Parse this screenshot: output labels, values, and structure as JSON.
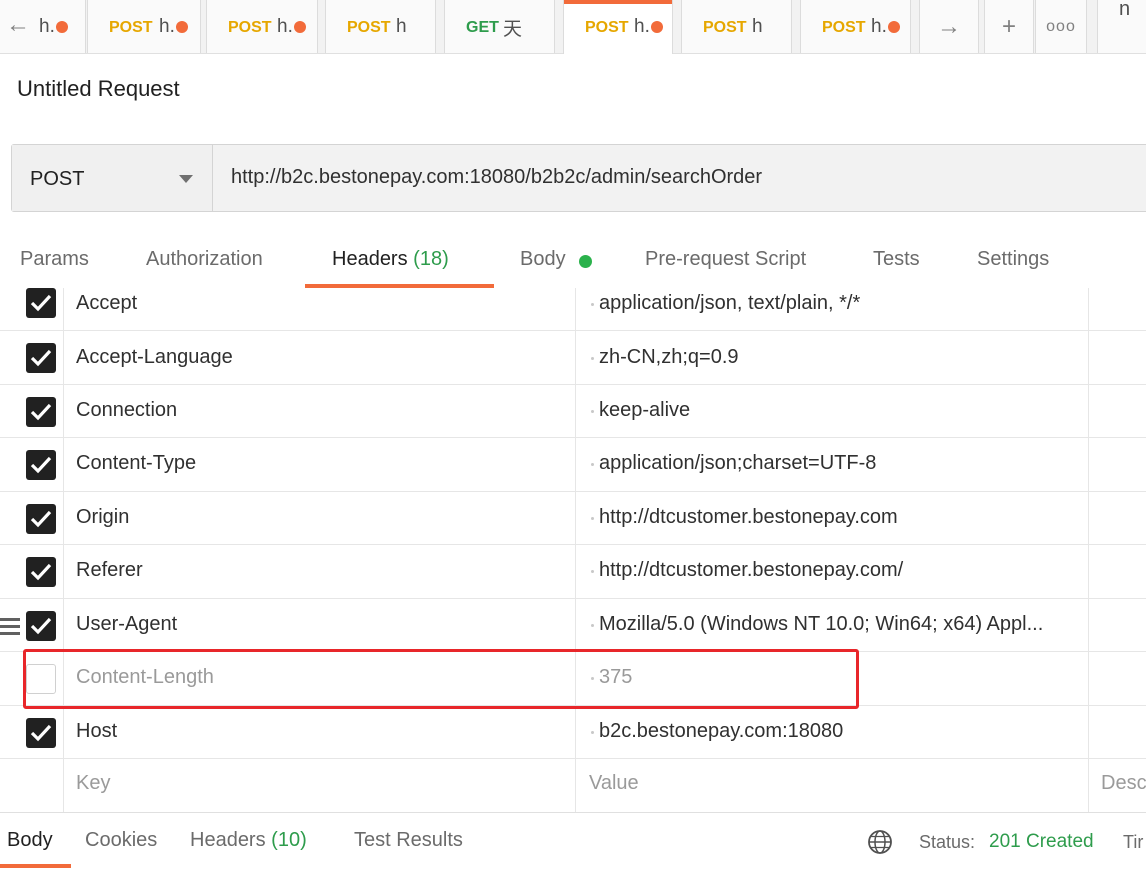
{
  "tabs": {
    "back_label": "h.",
    "items": [
      {
        "method": "POST",
        "name": "h."
      },
      {
        "method": "POST",
        "name": "h."
      },
      {
        "method": "POST",
        "name": "h"
      },
      {
        "method": "GET",
        "name": "天"
      },
      {
        "method": "POST",
        "name": "h."
      },
      {
        "method": "POST",
        "name": "h"
      },
      {
        "method": "POST",
        "name": "h."
      }
    ],
    "env_label": "n"
  },
  "request": {
    "title": "Untitled Request",
    "method": "POST",
    "url": "http://b2c.bestonepay.com:18080/b2b2c/admin/searchOrder"
  },
  "request_tabs": {
    "params": "Params",
    "authorization": "Authorization",
    "headers": "Headers",
    "headers_count": "(18)",
    "body": "Body",
    "pre_request": "Pre-request Script",
    "tests": "Tests",
    "settings": "Settings"
  },
  "headers": [
    {
      "key": "Accept",
      "value": "application/json, text/plain, */*",
      "enabled": true
    },
    {
      "key": "Accept-Language",
      "value": "zh-CN,zh;q=0.9",
      "enabled": true
    },
    {
      "key": "Connection",
      "value": "keep-alive",
      "enabled": true
    },
    {
      "key": "Content-Type",
      "value": "application/json;charset=UTF-8",
      "enabled": true
    },
    {
      "key": "Origin",
      "value": "http://dtcustomer.bestonepay.com",
      "enabled": true
    },
    {
      "key": "Referer",
      "value": "http://dtcustomer.bestonepay.com/",
      "enabled": true
    },
    {
      "key": "User-Agent",
      "value": "Mozilla/5.0 (Windows NT 10.0; Win64; x64) Appl...",
      "enabled": true
    },
    {
      "key": "Content-Length",
      "value": "375",
      "enabled": false
    },
    {
      "key": "Host",
      "value": "b2c.bestonepay.com:18080",
      "enabled": true
    }
  ],
  "new_row": {
    "key_placeholder": "Key",
    "value_placeholder": "Value",
    "desc_placeholder": "Desc"
  },
  "response": {
    "tabs": {
      "body": "Body",
      "cookies": "Cookies",
      "headers": "Headers",
      "headers_count": "(10)",
      "test_results": "Test Results"
    },
    "status_label": "Status:",
    "status_value": "201 Created",
    "time_label": "Tir"
  },
  "colors": {
    "accent": "#f26b3a",
    "post": "#e6a700",
    "get": "#2e9c4c",
    "success": "#2e9c4c",
    "highlight_box": "#e8262a"
  }
}
